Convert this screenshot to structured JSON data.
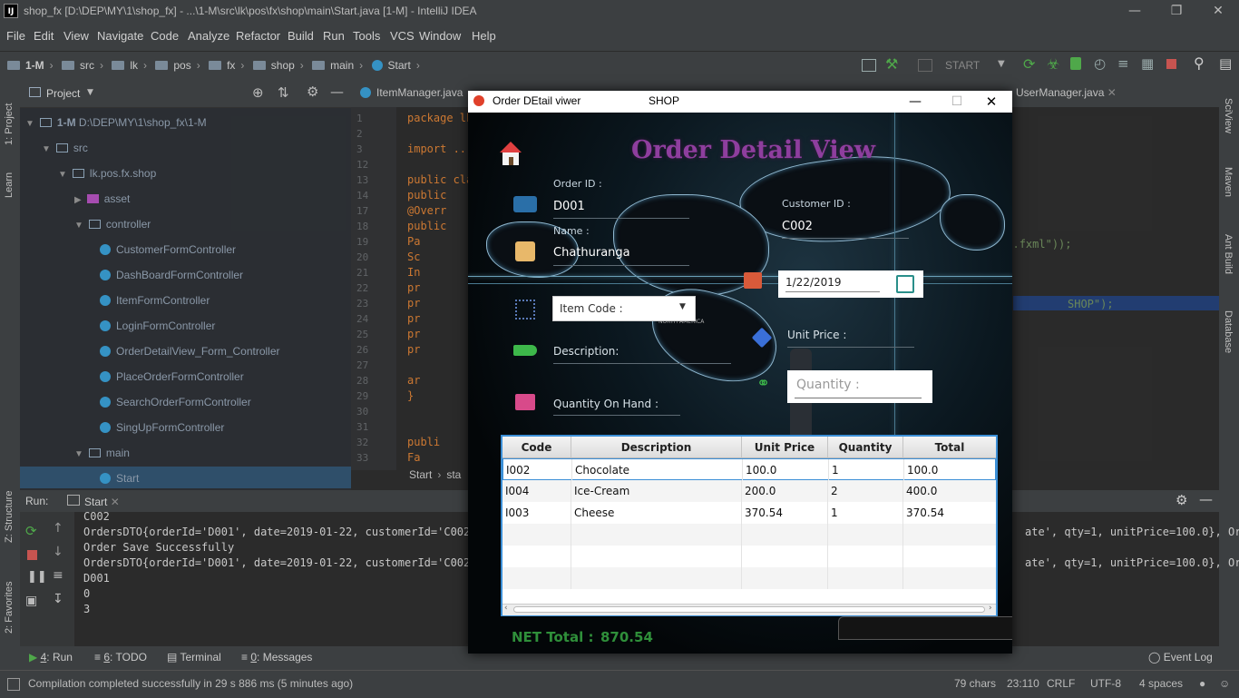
{
  "window": {
    "title": "shop_fx [D:\\DEP\\MY\\1\\shop_fx] - ...\\1-M\\src\\lk\\pos\\fx\\shop\\main\\Start.java [1-M] - IntelliJ IDEA",
    "logo": "IJ"
  },
  "menu": [
    "File",
    "Edit",
    "View",
    "Navigate",
    "Code",
    "Analyze",
    "Refactor",
    "Build",
    "Run",
    "Tools",
    "VCS",
    "Window",
    "Help"
  ],
  "breadcrumb": [
    "1-M",
    "src",
    "lk",
    "pos",
    "fx",
    "shop",
    "main",
    "Start"
  ],
  "toolbar": {
    "run_config": "START"
  },
  "left_tools": {
    "project": "1: Project",
    "learn": "Learn",
    "structure": "Z: Structure",
    "favorites": "2: Favorites"
  },
  "right_tools": {
    "sciview": "SciView",
    "maven": "Maven",
    "ant": "Ant Build",
    "database": "Database"
  },
  "project_panel": {
    "title": "Project",
    "root": "1-M",
    "root_path": "D:\\DEP\\MY\\1\\shop_fx\\1-M",
    "src": "src",
    "pkg": "lk.pos.fx.shop",
    "asset": "asset",
    "controller": "controller",
    "controllers": [
      "CustomerFormController",
      "DashBoardFormController",
      "ItemFormController",
      "LoginFormController",
      "OrderDetailView_Form_Controller",
      "PlaceOrderFormController",
      "SearchOrderFormController",
      "SingUpFormController"
    ],
    "main": "main",
    "start": "Start"
  },
  "editor": {
    "tabs": [
      "ItemManager.java",
      "UserManager.java"
    ],
    "line_numbers": [
      "1",
      "2",
      "3",
      "12",
      "13",
      "14",
      "17",
      "18",
      "19",
      "20",
      "21",
      "22",
      "23",
      "24",
      "25",
      "26",
      "27",
      "28",
      "29",
      "30",
      "31",
      "32",
      "33"
    ],
    "code": [
      "package lk",
      "",
      "import ...",
      "",
      "public cla",
      "  public",
      "  @Overr",
      "  public",
      "    Pa",
      "    Sc",
      "    In",
      "    pr",
      "    pr",
      "    pr",
      "    pr",
      "    pr",
      "",
      "    ar",
      "}",
      "",
      "",
      "publi",
      "  Fa"
    ],
    "right_fragments": [
      "n/LoginForm.fxml\"));",
      "SHOP\");"
    ],
    "bottom_crumbs": [
      "Start",
      "sta"
    ]
  },
  "run": {
    "label": "Run:",
    "tab": "Start",
    "output": [
      "C002",
      "OrdersDTO{orderId='D001', date=2019-01-22, customerId='C002',",
      "Order Save Successfully",
      "OrdersDTO{orderId='D001', date=2019-01-22, customerId='C002',",
      "D001",
      "0",
      "3"
    ],
    "output_right": [
      "ate', qty=1, unitPrice=100.0}, Or",
      "ate', qty=1, unitPrice=100.0}, Or"
    ]
  },
  "bottom_tabs": [
    {
      "num": "4",
      "label": "Run"
    },
    {
      "num": "6",
      "label": "TODO"
    },
    {
      "num": "",
      "label": "Terminal"
    },
    {
      "num": "0",
      "label": "Messages"
    }
  ],
  "event_log": "Event Log",
  "status": {
    "message": "Compilation completed successfully in 29 s 886 ms (5 minutes ago)",
    "chars": "79 chars",
    "pos": "23:110",
    "crlf": "CRLF",
    "enc": "UTF-8",
    "indent": "4 spaces"
  },
  "dialog": {
    "title": "Order DEtail viwer",
    "subtitle": "SHOP",
    "heading": "Order Detail View",
    "order_id_label": "Order ID :",
    "order_id": "D001",
    "name_label": "Name :",
    "name": "Chathuranga",
    "customer_id_label": "Customer ID :",
    "customer_id": "C002",
    "date": "1/22/2019",
    "item_code_placeholder": "Item Code :",
    "description_label": "Description:",
    "unit_price_label": "Unit Price :",
    "quantity_placeholder": "Quantity :",
    "qoh_label": "Quantity On Hand :",
    "map_text": "NORTH AMERICA",
    "table": {
      "headers": [
        "Code",
        "Description",
        "Unit Price",
        "Quantity",
        "Total"
      ],
      "rows": [
        [
          "I002",
          "Chocolate",
          "100.0",
          "1",
          "100.0"
        ],
        [
          "I004",
          "Ice-Cream",
          "200.0",
          "2",
          "400.0"
        ],
        [
          "I003",
          "Cheese",
          "370.54",
          "1",
          "370.54"
        ]
      ]
    },
    "net_total_label": "NET Total :",
    "net_total": "870.54"
  },
  "colors": {
    "heading": "#8e3e9e",
    "net_total": "#2f8f3a",
    "ide_bg": "#2b2b2b",
    "panel": "#3c3f41",
    "accent_blue": "#3c8fd6"
  }
}
